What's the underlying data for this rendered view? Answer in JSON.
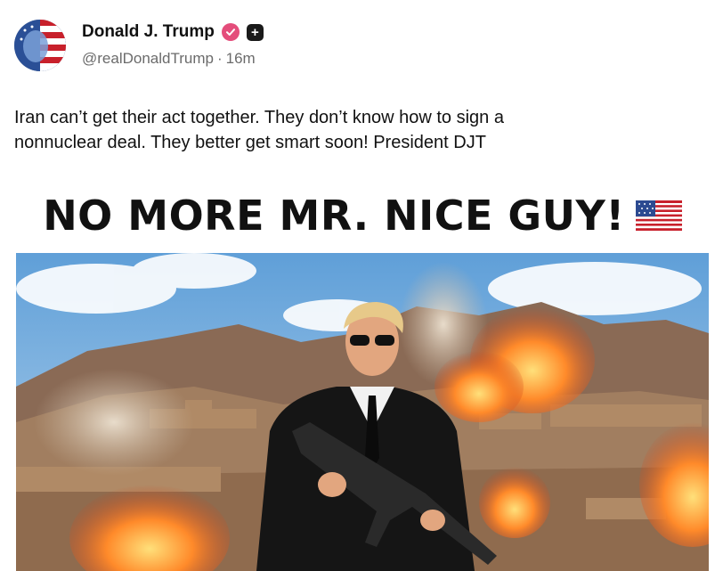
{
  "post": {
    "author": {
      "display_name": "Donald J. Trump",
      "handle": "@realDonaldTrump",
      "time_sep": "·",
      "time": "16m"
    },
    "text": "Iran can’t get their act together. They don’t know how to sign a\nnonnuclear deal. They better get smart soon! President DJT",
    "media": {
      "banner_text": "NO MORE MR. NICE GUY!",
      "image_alt": "Man in suit and sunglasses holding rifle with explosions on desert hillside"
    }
  },
  "colors": {
    "verified_badge": "#e44d7b",
    "plus_badge": "#1a1a1a",
    "muted_text": "#6b6b6b"
  },
  "icons": {
    "verified": "verified-check-icon",
    "plus": "plus-badge-icon",
    "flag": "us-flag-icon"
  }
}
